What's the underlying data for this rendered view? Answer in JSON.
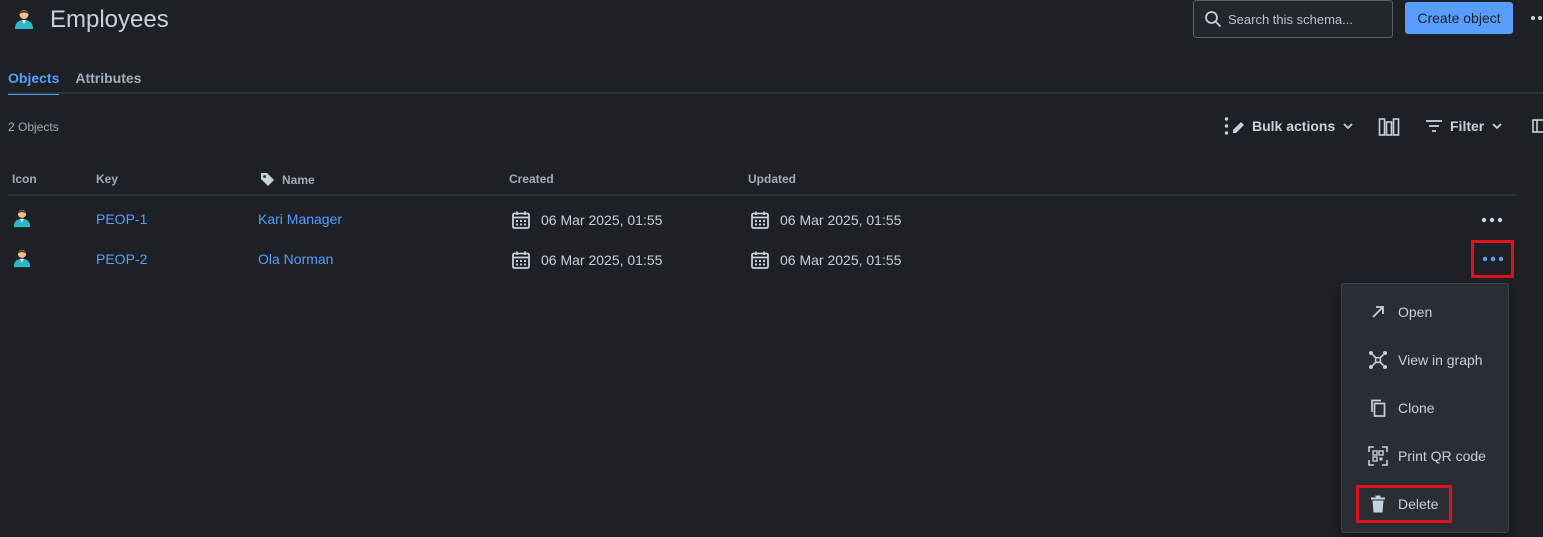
{
  "header": {
    "title": "Employees",
    "search_placeholder": "Search this schema...",
    "create_label": "Create object"
  },
  "tabs": [
    {
      "label": "Objects",
      "active": true
    },
    {
      "label": "Attributes",
      "active": false
    }
  ],
  "toolbar": {
    "count": "2 Objects",
    "bulk_actions": "Bulk actions",
    "filter": "Filter"
  },
  "table": {
    "headers": {
      "icon": "Icon",
      "key": "Key",
      "name": "Name",
      "created": "Created",
      "updated": "Updated"
    },
    "rows": [
      {
        "key": "PEOP-1",
        "name": "Kari Manager",
        "created": "06 Mar 2025, 01:55",
        "updated": "06 Mar 2025, 01:55"
      },
      {
        "key": "PEOP-2",
        "name": "Ola Norman",
        "created": "06 Mar 2025, 01:55",
        "updated": "06 Mar 2025, 01:55"
      }
    ]
  },
  "menu": {
    "items": [
      {
        "label": "Open",
        "icon": "arrow-up-right-icon"
      },
      {
        "label": "View in graph",
        "icon": "graph-icon"
      },
      {
        "label": "Clone",
        "icon": "copy-icon"
      },
      {
        "label": "Print QR code",
        "icon": "qr-code-icon"
      },
      {
        "label": "Delete",
        "icon": "trash-icon"
      }
    ]
  },
  "colors": {
    "accent": "#579dff",
    "highlight": "#e0101d",
    "background": "#1d2125"
  }
}
